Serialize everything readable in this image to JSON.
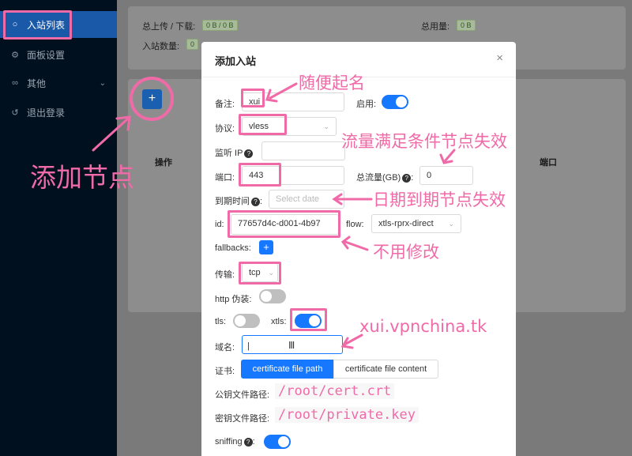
{
  "sidebar": {
    "items": [
      {
        "label": "入站列表",
        "icon": "user-icon"
      },
      {
        "label": "面板设置",
        "icon": "settings-icon"
      },
      {
        "label": "其他",
        "icon": "link-icon"
      },
      {
        "label": "退出登录",
        "icon": "logout-icon"
      }
    ]
  },
  "stats": {
    "upload_download_label": "总上传 / 下载:",
    "upload_download_value": "0 B / 0 B",
    "total_usage_label": "总用量:",
    "total_usage_value": "0 B",
    "inbound_count_label": "入站数量:",
    "inbound_count_value": "0"
  },
  "table": {
    "add_button": "+",
    "col_actions": "操作",
    "col_port": "端口"
  },
  "modal": {
    "title": "添加入站",
    "close": "×",
    "remark_label": "备注:",
    "remark_value": "xui",
    "enable_label": "启用:",
    "protocol_label": "协议:",
    "protocol_value": "vless",
    "listen_ip_label": "监听 IP",
    "listen_ip_value": "",
    "port_label": "端口:",
    "port_value": "443",
    "total_traffic_label": "总流量(GB)",
    "total_traffic_value": "0",
    "expiry_label": "到期时间",
    "expiry_placeholder": "Select date",
    "id_label": "id:",
    "id_value": "77657d4c-d001-4b97",
    "flow_label": "flow:",
    "flow_value": "xtls-rprx-direct",
    "fallbacks_label": "fallbacks:",
    "fallbacks_button": "+",
    "transport_label": "传输:",
    "transport_value": "tcp",
    "http_camouflage_label": "http 伪装:",
    "tls_label": "tls:",
    "xtls_label": "xtls:",
    "domain_label": "域名:",
    "domain_value": "",
    "cert_label": "证书:",
    "cert_tab_path": "certificate file path",
    "cert_tab_content": "certificate file content",
    "public_key_label": "公钥文件路径:",
    "public_key_value": "/root/cert.crt",
    "private_key_label": "密钥文件路径:",
    "private_key_value": "/root/private.key",
    "sniffing_label": "sniffing"
  },
  "toggles": {
    "enable": true,
    "http_camouflage": false,
    "tls": false,
    "xtls": true,
    "sniffing": true
  },
  "annotations": {
    "random_name": "随便起名",
    "add_node": "添加节点",
    "traffic_expire": "流量满足条件节点失效",
    "date_expire": "日期到期节点失效",
    "no_change": "不用修改",
    "domain_example": "xui.vpnchina.tk",
    "color": "#f06aa8"
  }
}
